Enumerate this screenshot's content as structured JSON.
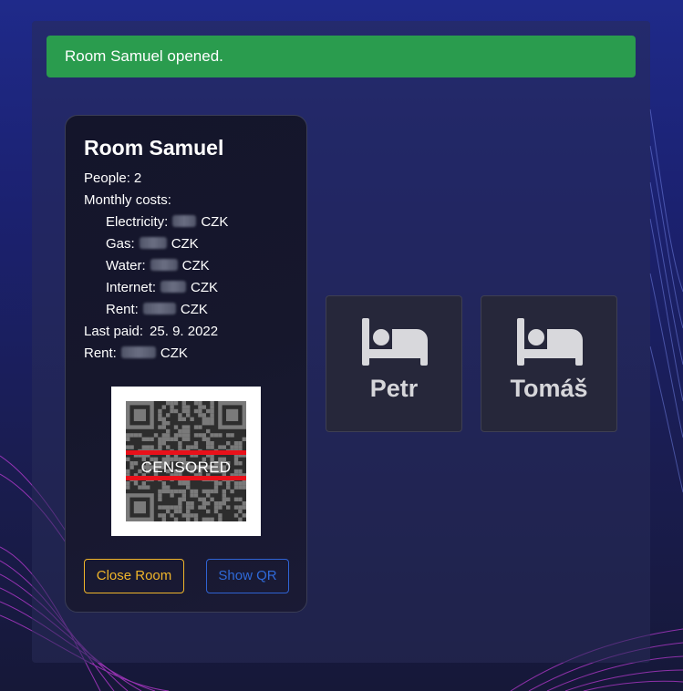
{
  "alert": {
    "message": "Room Samuel opened."
  },
  "room": {
    "title": "Room Samuel",
    "people_label": "People:",
    "people_value": "2",
    "monthly_costs_label": "Monthly costs:",
    "costs": [
      {
        "label": "Electricity:",
        "currency": "CZK"
      },
      {
        "label": "Gas:",
        "currency": "CZK"
      },
      {
        "label": "Water:",
        "currency": "CZK"
      },
      {
        "label": "Internet:",
        "currency": "CZK"
      },
      {
        "label": "Rent:",
        "currency": "CZK"
      }
    ],
    "last_paid_label": "Last paid:",
    "last_paid_value": "25. 9. 2022",
    "rent_label": "Rent:",
    "rent_currency": "CZK",
    "qr_overlay_text": "CENSORED",
    "close_button": "Close Room",
    "show_qr_button": "Show QR"
  },
  "people": [
    {
      "name": "Petr",
      "icon": "bed-icon"
    },
    {
      "name": "Tomáš",
      "icon": "bed-icon"
    }
  ],
  "colors": {
    "success": "#2a9c4e",
    "warning": "#f0b52a",
    "primary": "#2f63d3",
    "qr_censor_bar": "#e8111a"
  }
}
